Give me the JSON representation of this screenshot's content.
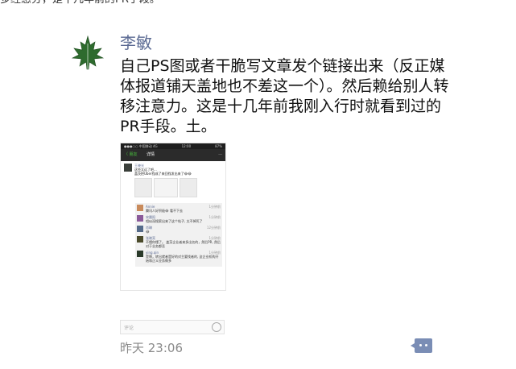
{
  "prev_text": "多经感分，是十几年前的PR手段。",
  "post": {
    "author": "李敏",
    "text": "自己PS图或者干脆写文章发个链接出来（反正媒体报道铺天盖地也不差这一个）。然后赖给别人转移注意力。这是十几年前我刚入行时就看到过的PR手段。土。",
    "timestamp": "昨天 23:06"
  },
  "embedded_screenshot": {
    "status_left": "●●●○○ 中国移动 4G",
    "status_center": "12:00",
    "status_right": "87%",
    "nav_back": "〈 朋友",
    "nav_title": "详情",
    "nav_more": "···",
    "inner_author": "王晓光",
    "inner_text_1": "这些太远了吧...",
    "inner_text_2": "盖茨把Uber找成了来回找发出来了😂😂",
    "comments": [
      {
        "name": "Annie",
        "time": "1分钟前",
        "text": "腾讯人好积极😂 看不下去"
      },
      {
        "name": "宋晨阳",
        "time": "1分钟前",
        "text": "相似深搜索出来了这个帖子, 太不掉死了"
      },
      {
        "name": "肖琳",
        "time": "12分钟前",
        "text": "😂"
      },
      {
        "name": "张晓亮",
        "time": "1分钟前",
        "text": "不懂你懂了。 盖茨企业者来多出名的，然后PR, 然后对于业务都丢"
      },
      {
        "name": "ying.qin",
        "time": "1分钟前",
        "text": "是啊，转出就者是好的对主要找者的, 这企业机构开始和正义业务做多"
      }
    ]
  },
  "comment_input": {
    "placeholder": "评论"
  },
  "icons": {
    "avatar": "maple-leaf-icon",
    "action": "comment-dots-icon",
    "smile": "emoji-icon"
  },
  "colors": {
    "author_name": "#5b6a93",
    "timestamp": "#8a8a8a",
    "action_button": "#7a8db5",
    "leaf": "#2e6b2e"
  }
}
